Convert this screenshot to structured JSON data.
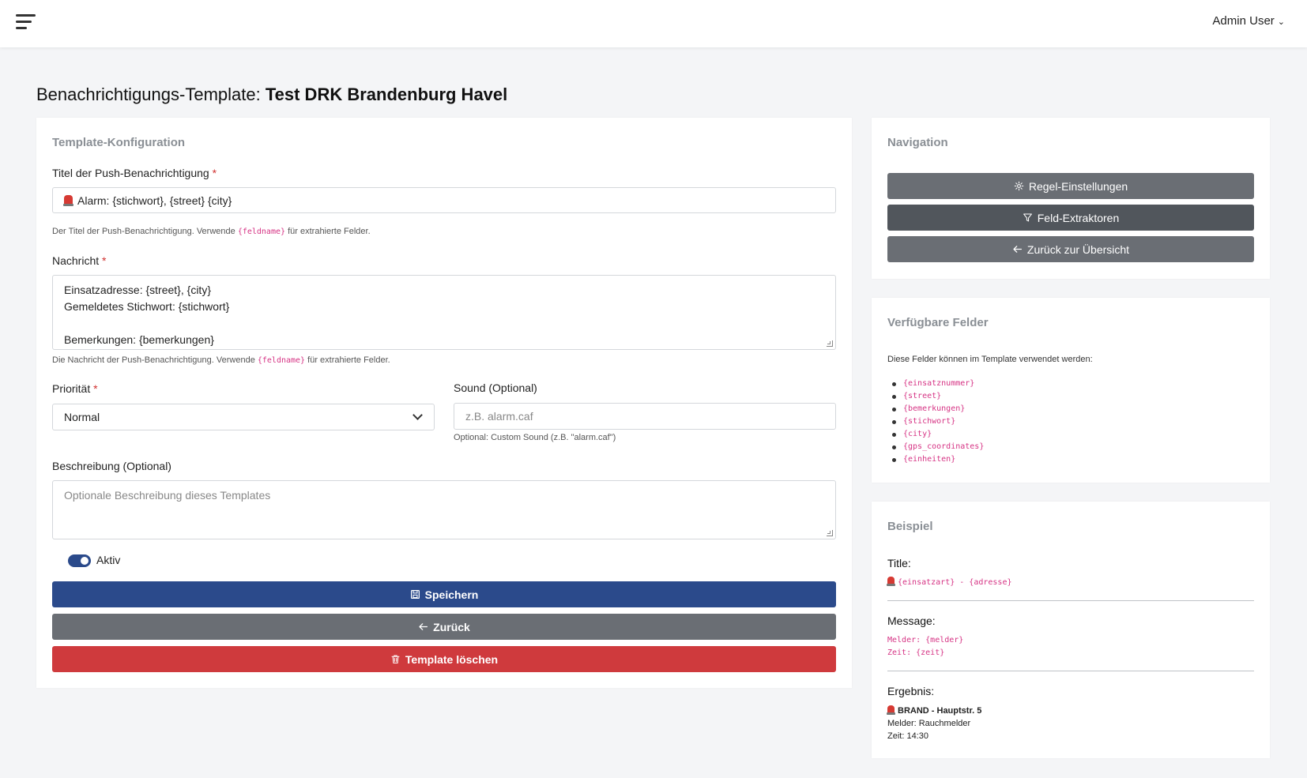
{
  "header": {
    "menu_icon": "hamburger-menu-icon",
    "user_name": "Admin User",
    "user_chevron": "chevron-down-icon"
  },
  "page": {
    "title_prefix": "Benachrichtigungs-Template:",
    "title_name": "Test DRK Brandenburg Havel"
  },
  "form": {
    "card_title": "Template-Konfiguration",
    "push_title": {
      "label": "Titel der Push-Benachrichtigung",
      "required_mark": "*",
      "value": "Alarm: {stichwort}, {street} {city}",
      "icon": "rotating-light-emoji-icon",
      "help_before": "Der Titel der Push-Benachrichtigung. Verwende",
      "help_code": "{feldname}",
      "help_after": "für extrahierte Felder."
    },
    "message": {
      "label": "Nachricht",
      "required_mark": "*",
      "lines": [
        "Einsatzadresse: {street}, {city}",
        "Gemeldetes Stichwort: {stichwort}",
        "",
        "Bemerkungen: {bemerkungen}"
      ],
      "help_before": "Die Nachricht der Push-Benachrichtigung. Verwende",
      "help_code": "{feldname}",
      "help_after": "für extrahierte Felder."
    },
    "priority": {
      "label": "Priorität",
      "required_mark": "*",
      "selected": "Normal"
    },
    "sound": {
      "label": "Sound (Optional)",
      "placeholder": "z.B. alarm.caf",
      "help": "Optional: Custom Sound (z.B. \"alarm.caf\")"
    },
    "description": {
      "label": "Beschreibung (Optional)",
      "placeholder": "Optionale Beschreibung dieses Templates"
    },
    "active": {
      "label": "Aktiv",
      "enabled": true
    },
    "buttons": {
      "save": "Speichern",
      "back": "Zurück",
      "delete": "Template löschen"
    }
  },
  "navigation": {
    "card_title": "Navigation",
    "rules": "Regel-Einstellungen",
    "extractors": "Feld-Extraktoren",
    "overview": "Zurück zur Übersicht"
  },
  "fields": {
    "card_title": "Verfügbare Felder",
    "intro": "Diese Felder können im Template verwendet werden:",
    "items": [
      "{einsatznummer}",
      "{street}",
      "{bemerkungen}",
      "{stichwort}",
      "{city}",
      "{gps_coordinates}",
      "{einheiten}"
    ]
  },
  "example": {
    "card_title": "Beispiel",
    "title_label": "Title:",
    "title_code": "{einsatzart} - {adresse}",
    "message_label": "Message:",
    "message_lines": [
      "Melder: {melder}",
      "Zeit: {zeit}"
    ],
    "result_label": "Ergebnis:",
    "result_title": "BRAND - Hauptstr. 5",
    "result_lines": [
      "Melder: Rauchmelder",
      "Zeit: 14:30"
    ]
  },
  "colors": {
    "primary": "#2b4a8b",
    "secondary": "#6a6e74",
    "danger": "#cf3a3d",
    "code": "#d63384"
  }
}
